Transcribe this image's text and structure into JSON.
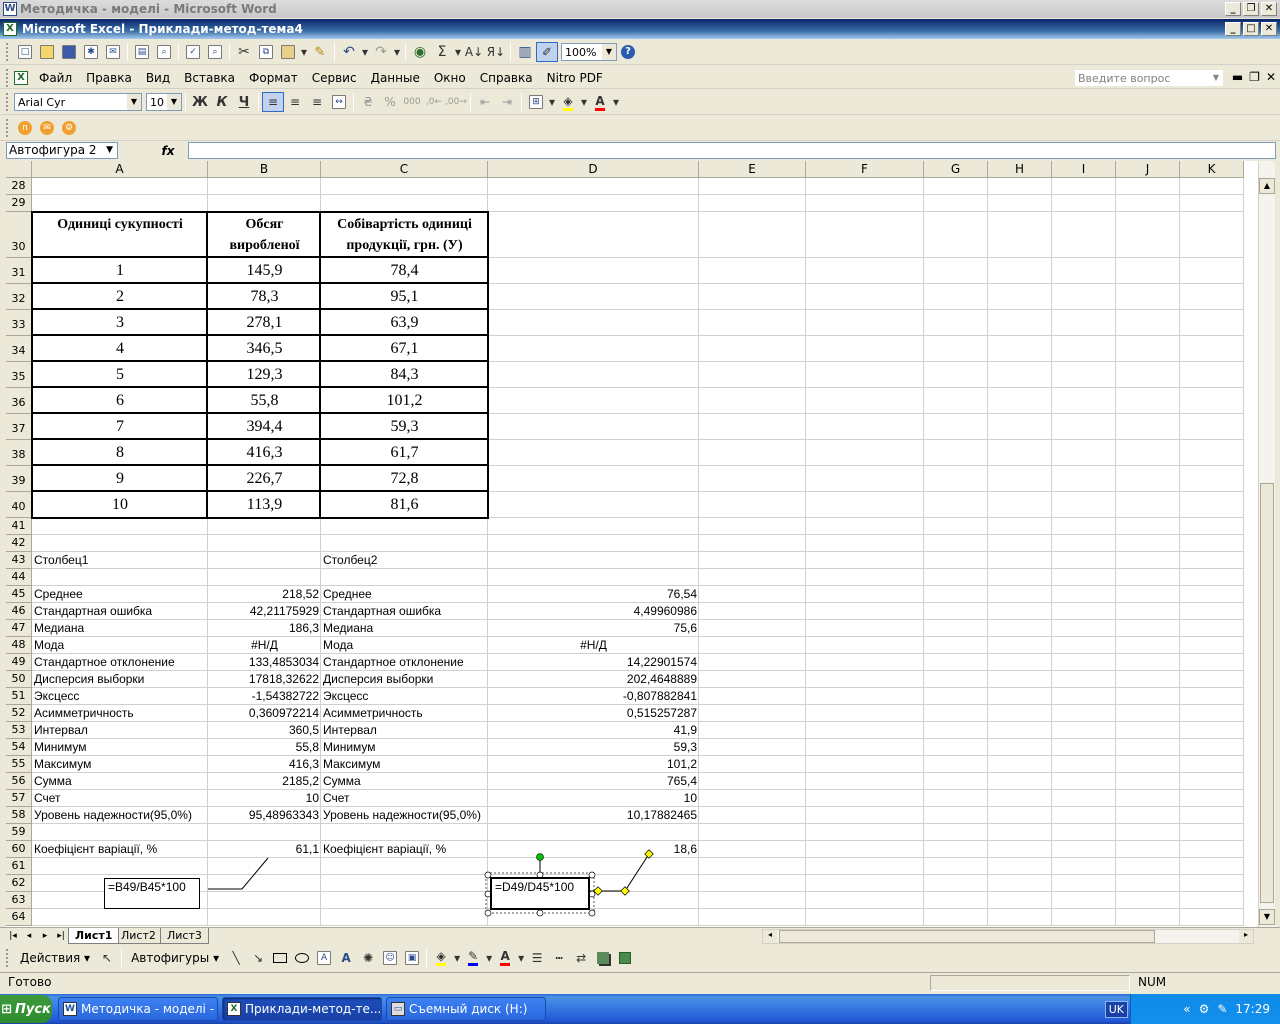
{
  "word_window": {
    "title": "Методичка - моделі - Microsoft Word"
  },
  "excel_window": {
    "title": "Microsoft Excel - Приклади-метод-тема4"
  },
  "standard_toolbar": {
    "zoom": "100%"
  },
  "menu": [
    "Файл",
    "Правка",
    "Вид",
    "Вставка",
    "Формат",
    "Сервис",
    "Данные",
    "Окно",
    "Справка",
    "Nitro PDF"
  ],
  "help_search": {
    "placeholder": "Введите вопрос"
  },
  "format_toolbar": {
    "font": "Arial Cyr",
    "size": "10",
    "bold": "Ж",
    "italic": "К",
    "underline": "Ч"
  },
  "formula_bar": {
    "name_box": "Автофигура 2",
    "fx": "fx",
    "content": ""
  },
  "columns": [
    "A",
    "B",
    "C",
    "D",
    "E",
    "F",
    "G",
    "H",
    "I",
    "J",
    "K"
  ],
  "rows": [
    "28",
    "29",
    "30",
    "31",
    "32",
    "33",
    "34",
    "35",
    "36",
    "37",
    "38",
    "39",
    "40",
    "41",
    "42",
    "43",
    "44",
    "45",
    "46",
    "47",
    "48",
    "49",
    "50",
    "51",
    "52",
    "53",
    "54",
    "55",
    "56",
    "57",
    "58",
    "59",
    "60",
    "61",
    "62",
    "63",
    "64"
  ],
  "data_table": {
    "headers": {
      "a_line1": "Одиниці сукупності",
      "b_line1": "Обсяг",
      "b_line2": "виробленої",
      "c_line1": "Собівартість одиниці",
      "c_line2": "продукції, грн. (У)"
    },
    "rows": [
      {
        "a": "1",
        "b": "145,9",
        "c": "78,4"
      },
      {
        "a": "2",
        "b": "78,3",
        "c": "95,1"
      },
      {
        "a": "3",
        "b": "278,1",
        "c": "63,9"
      },
      {
        "a": "4",
        "b": "346,5",
        "c": "67,1"
      },
      {
        "a": "5",
        "b": "129,3",
        "c": "84,3"
      },
      {
        "a": "6",
        "b": "55,8",
        "c": "101,2"
      },
      {
        "a": "7",
        "b": "394,4",
        "c": "59,3"
      },
      {
        "a": "8",
        "b": "416,3",
        "c": "61,7"
      },
      {
        "a": "9",
        "b": "226,7",
        "c": "72,8"
      },
      {
        "a": "10",
        "b": "113,9",
        "c": "81,6"
      }
    ]
  },
  "stats": {
    "col1_title": "Столбец1",
    "col2_title": "Столбец2",
    "rows": [
      {
        "label": "Среднее",
        "v1": "218,52",
        "label2": "Среднее",
        "v2": "76,54"
      },
      {
        "label": "Стандартная ошибка",
        "v1": "42,21175929",
        "label2": "Стандартная ошибка",
        "v2": "4,49960986"
      },
      {
        "label": "Медиана",
        "v1": "186,3",
        "label2": "Медиана",
        "v2": "75,6"
      },
      {
        "label": "Мода",
        "v1": "#Н/Д",
        "label2": "Мода",
        "v2": "#Н/Д"
      },
      {
        "label": "Стандартное отклонение",
        "v1": "133,4853034",
        "label2": "Стандартное отклонение",
        "v2": "14,22901574"
      },
      {
        "label": "Дисперсия выборки",
        "v1": "17818,32622",
        "label2": "Дисперсия выборки",
        "v2": "202,4648889"
      },
      {
        "label": "Эксцесс",
        "v1": "-1,54382722",
        "label2": "Эксцесс",
        "v2": "-0,807882841"
      },
      {
        "label": "Асимметричность",
        "v1": "0,360972214",
        "label2": "Асимметричность",
        "v2": "0,515257287"
      },
      {
        "label": "Интервал",
        "v1": "360,5",
        "label2": "Интервал",
        "v2": "41,9"
      },
      {
        "label": "Минимум",
        "v1": "55,8",
        "label2": "Минимум",
        "v2": "59,3"
      },
      {
        "label": "Максимум",
        "v1": "416,3",
        "label2": "Максимум",
        "v2": "101,2"
      },
      {
        "label": "Сумма",
        "v1": "2185,2",
        "label2": "Сумма",
        "v2": "765,4"
      },
      {
        "label": "Счет",
        "v1": "10",
        "label2": "Счет",
        "v2": "10"
      },
      {
        "label": "Уровень надежности(95,0%)",
        "v1": "95,48963343",
        "label2": "Уровень надежности(95,0%)",
        "v2": "10,17882465"
      }
    ],
    "variation": {
      "label": "Коефіцієнт варіації, %",
      "v1": "61,1",
      "label2": "Коефіцієнт варіації, %",
      "v2": "18,6"
    }
  },
  "callouts": {
    "formula1": "=B49/B45*100",
    "formula2": "=D49/D45*100"
  },
  "sheets": [
    "Лист1",
    "Лист2",
    "Лист3"
  ],
  "drawing_toolbar": {
    "actions": "Действия",
    "autoshapes": "Автофигуры"
  },
  "status": {
    "ready": "Готово",
    "num": "NUM"
  },
  "taskbar": {
    "start": "Пуск",
    "tasks": [
      "Методичка - моделі - Mi...",
      "Приклади-метод-те...",
      "Съемный диск (H:)"
    ],
    "lang": "UK",
    "time": "17:29"
  }
}
